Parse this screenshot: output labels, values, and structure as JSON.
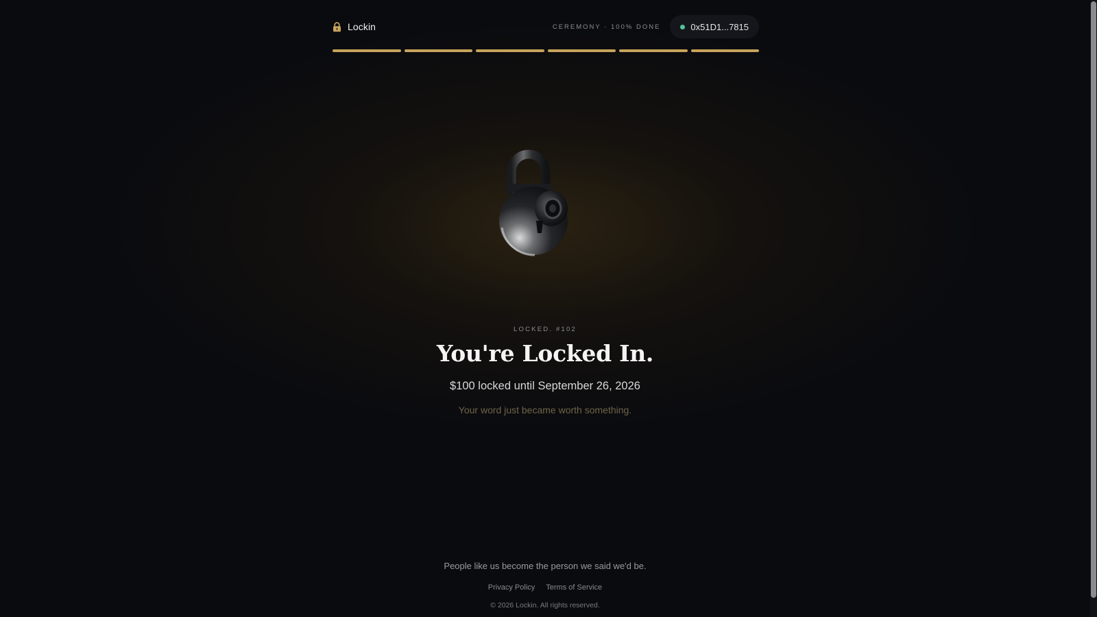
{
  "header": {
    "brand_name": "Lockin",
    "brand_icon": "lock-icon",
    "ceremony_status": "CEREMONY · 100% DONE",
    "wallet_address": "0x51D1...7815",
    "wallet_status_color": "#4fc497"
  },
  "progress": {
    "total_steps": 6,
    "completed_steps": 6,
    "accent_color": "#c8a35b"
  },
  "hero": {
    "image": "padlock-illustration",
    "eyebrow": "LOCKED. #102",
    "headline": "You're Locked In.",
    "summary": "$100 locked until September 26, 2026",
    "tagline": "Your word just became worth something."
  },
  "footer": {
    "quote": "People like us become the person we said we'd be.",
    "links": [
      {
        "label": "Privacy Policy"
      },
      {
        "label": "Terms of Service"
      }
    ],
    "copyright": "© 2026 Lockin. All rights reserved."
  }
}
